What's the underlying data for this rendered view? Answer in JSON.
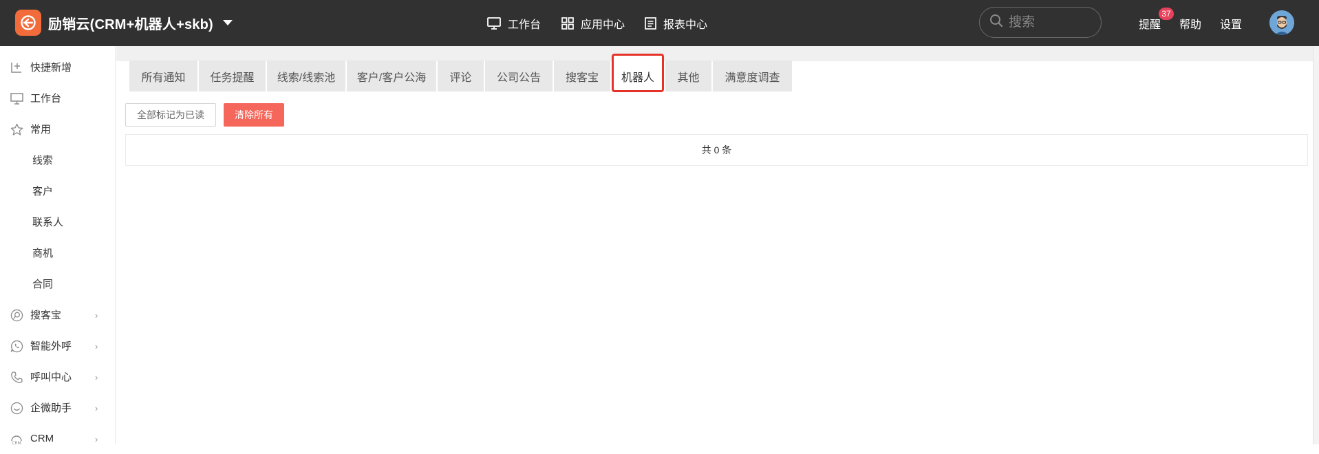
{
  "brand": {
    "title": "励销云(CRM+机器人+skb)"
  },
  "topnav": [
    {
      "label": "工作台",
      "icon": "monitor-icon"
    },
    {
      "label": "应用中心",
      "icon": "grid-icon"
    },
    {
      "label": "报表中心",
      "icon": "report-icon"
    }
  ],
  "search": {
    "placeholder": "搜索"
  },
  "header_links": {
    "remind": "提醒",
    "remind_count": "37",
    "help": "帮助",
    "settings": "设置"
  },
  "sidebar": {
    "items": [
      {
        "label": "快捷新增",
        "icon": "quick-add-icon"
      },
      {
        "label": "工作台",
        "icon": "monitor-icon"
      },
      {
        "label": "常用",
        "icon": "star-icon"
      },
      {
        "label": "线索"
      },
      {
        "label": "客户"
      },
      {
        "label": "联系人"
      },
      {
        "label": "商机"
      },
      {
        "label": "合同"
      },
      {
        "label": "搜客宝",
        "icon": "search-customer-icon",
        "has_arrow": true
      },
      {
        "label": "智能外呼",
        "icon": "phone-bubble-icon",
        "has_arrow": true
      },
      {
        "label": "呼叫中心",
        "icon": "phone-icon",
        "has_arrow": true
      },
      {
        "label": "企微助手",
        "icon": "wecom-icon",
        "has_arrow": true
      },
      {
        "label": "CRM",
        "icon": "crm-icon",
        "has_arrow": true
      }
    ]
  },
  "tabs": [
    {
      "label": "所有通知",
      "active": false
    },
    {
      "label": "任务提醒",
      "active": false
    },
    {
      "label": "线索/线索池",
      "active": false
    },
    {
      "label": "客户/客户公海",
      "active": false
    },
    {
      "label": "评论",
      "active": false
    },
    {
      "label": "公司公告",
      "active": false
    },
    {
      "label": "搜客宝",
      "active": false
    },
    {
      "label": "机器人",
      "active": true
    },
    {
      "label": "其他",
      "active": false
    },
    {
      "label": "满意度调查",
      "active": false
    }
  ],
  "actions": {
    "mark_all_read": "全部标记为已读",
    "clear_all": "清除所有"
  },
  "list": {
    "count_text": "共 0 条"
  },
  "colors": {
    "topbar": "#313131",
    "brand_orange": "#f26b3a",
    "clear_button": "#f5665b",
    "active_tab_border": "#e53329",
    "badge": "#e8415b"
  }
}
